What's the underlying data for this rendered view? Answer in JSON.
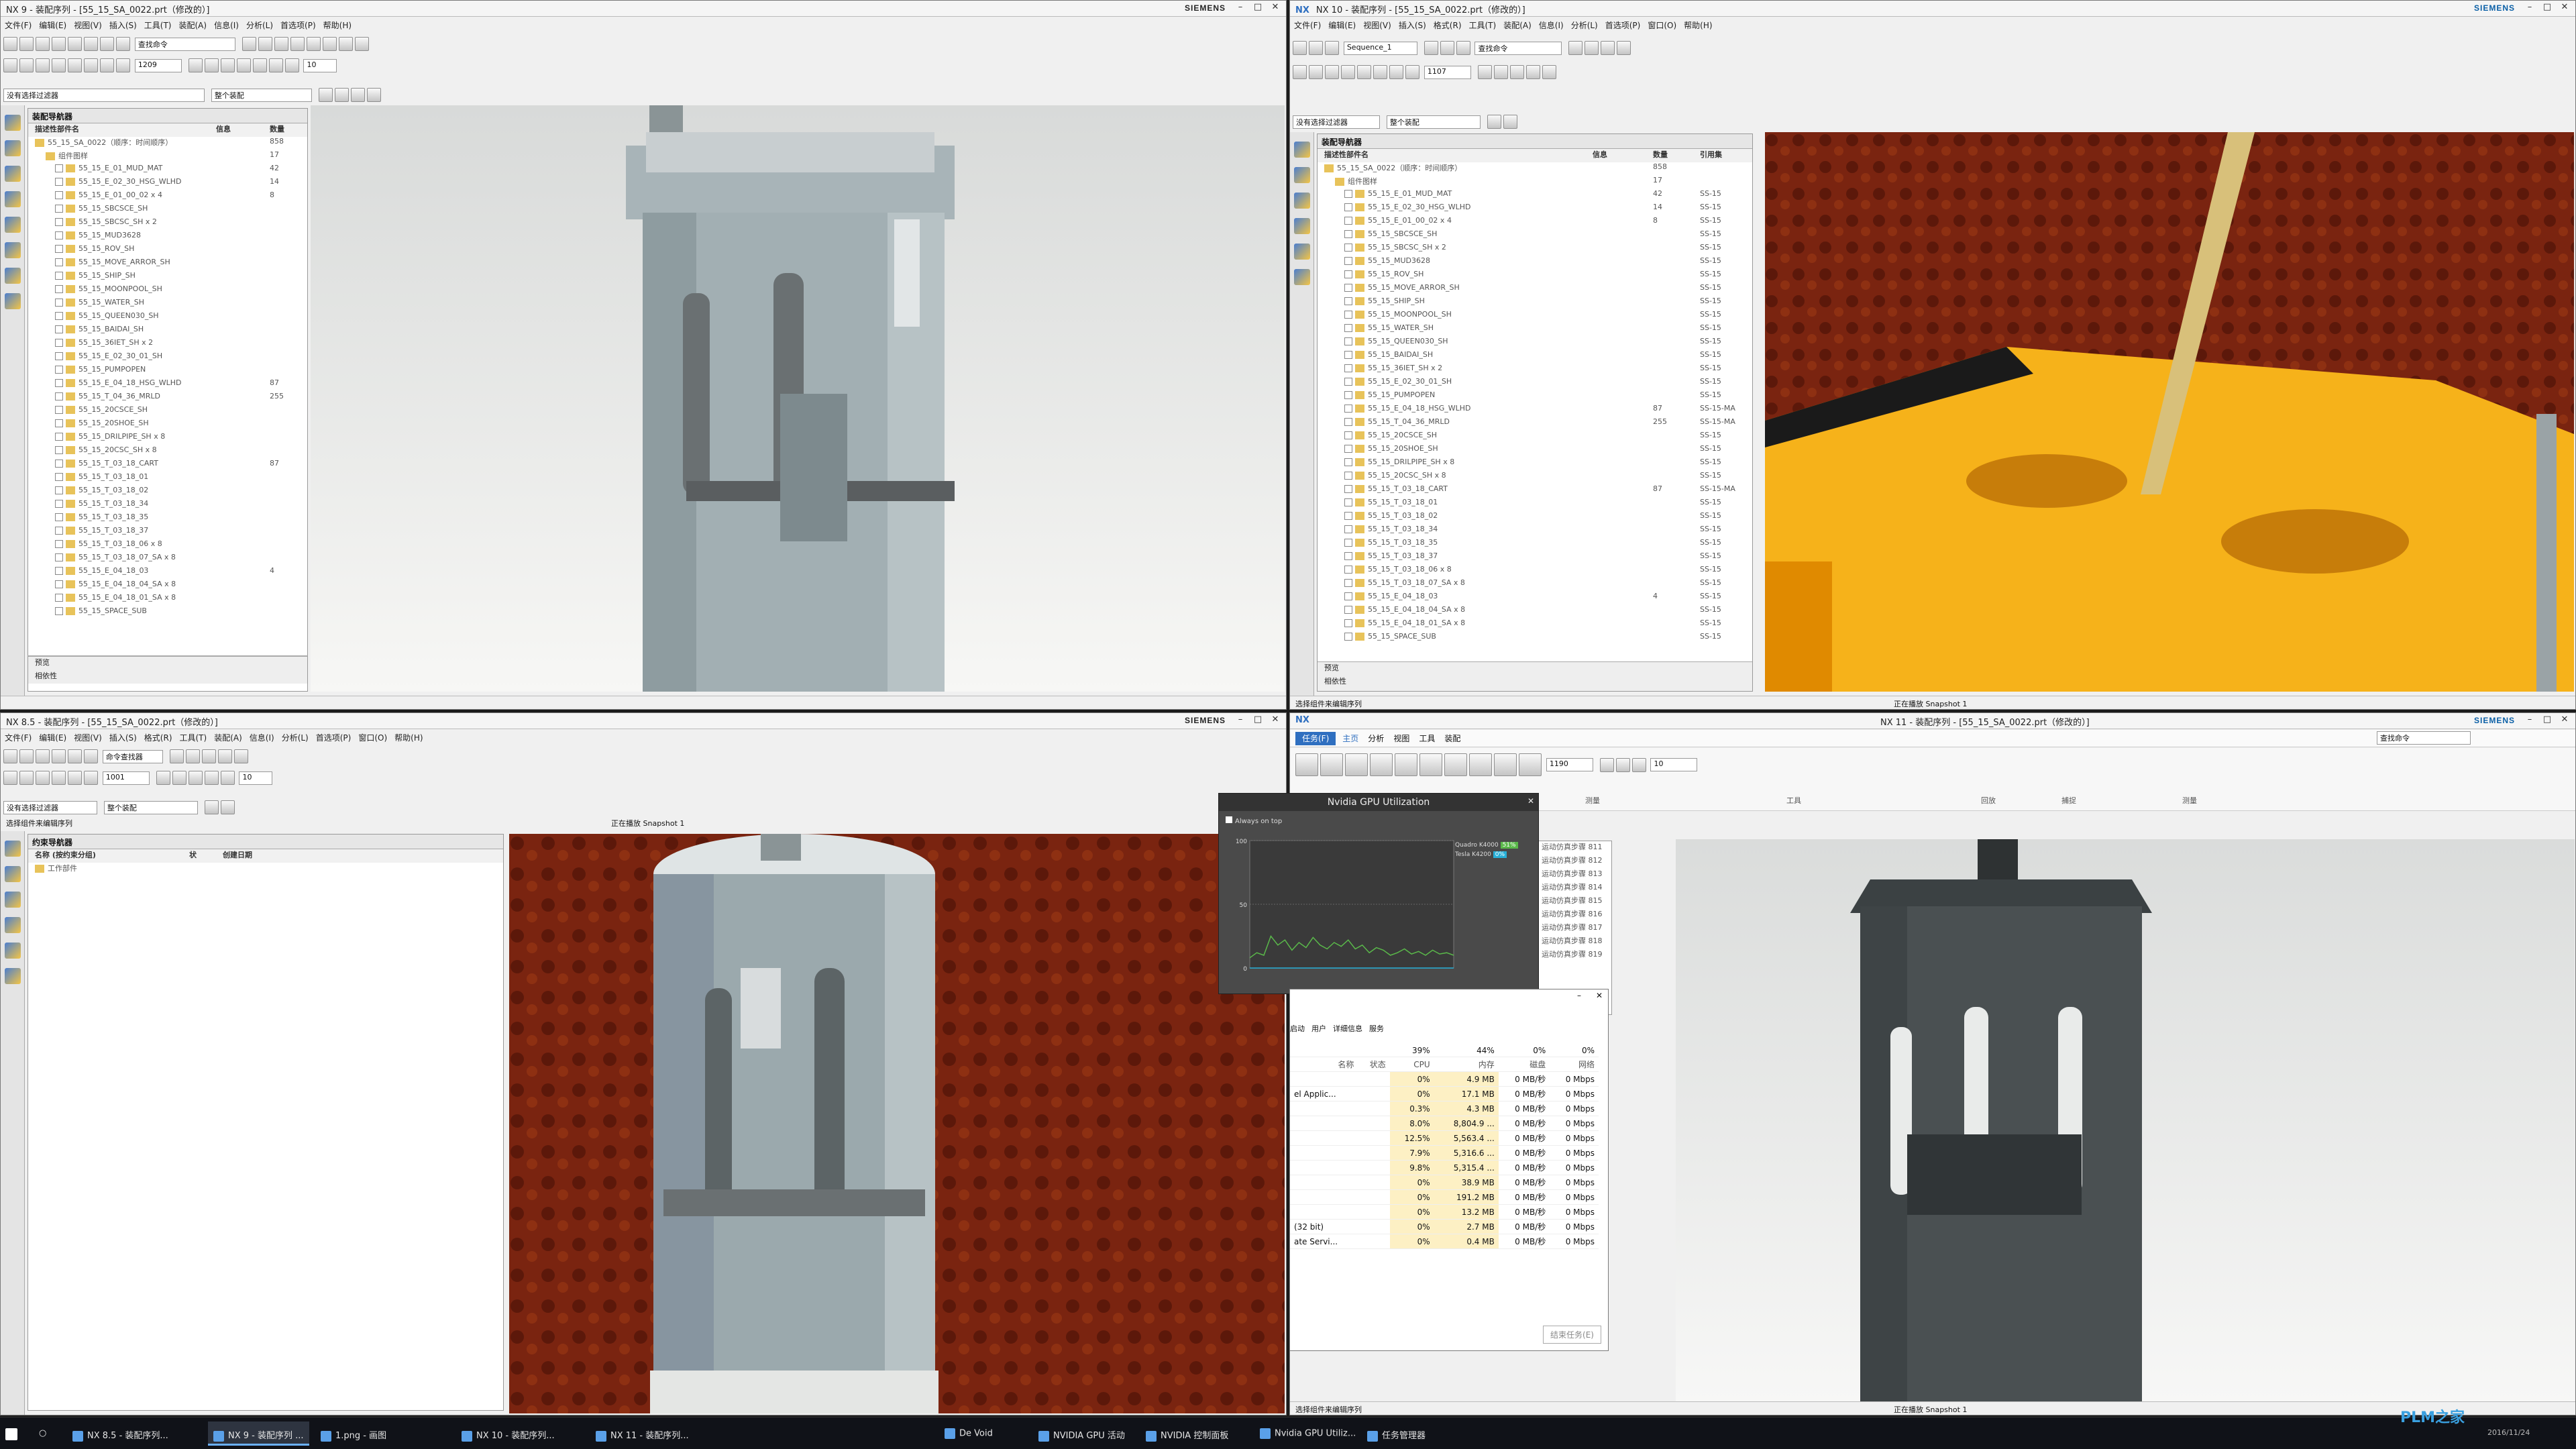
{
  "w1": {
    "title": "NX 9 - 装配序列 - [55_15_SA_0022.prt（修改的）]",
    "brand": "SIEMENS",
    "menu": [
      "文件(F)",
      "编辑(E)",
      "视图(V)",
      "插入(S)",
      "工具(T)",
      "装配(A)",
      "信息(I)",
      "分析(L)",
      "首选项(P)",
      "帮助(H)"
    ],
    "filter": "没有选择过滤器",
    "scope": "整个装配",
    "cmd": "查找命令",
    "frame": "1209",
    "step": "10",
    "nav_title": "装配导航器",
    "cols": [
      "描述性部件名",
      "信息",
      "数量"
    ],
    "root": "55_15_SA_0022（顺序：时间顺序）",
    "root_qty": "858",
    "group": "组件图样",
    "group_qty": "17",
    "rows": [
      "55_15_E_01_MUD_MAT",
      "55_15_E_02_30_HSG_WLHD",
      "55_15_E_01_00_02 x 4",
      "55_15_SBCSCE_SH",
      "55_15_SBCSC_SH x 2",
      "55_15_MUD3628",
      "55_15_ROV_SH",
      "55_15_MOVE_ARROR_SH",
      "55_15_SHIP_SH",
      "55_15_MOONPOOL_SH",
      "55_15_WATER_SH",
      "55_15_QUEEN030_SH",
      "55_15_BAIDAI_SH",
      "55_15_36IET_SH x 2",
      "55_15_E_02_30_01_SH",
      "55_15_PUMPOPEN",
      "55_15_E_04_18_HSG_WLHD",
      "55_15_T_04_36_MRLD",
      "55_15_20CSCE_SH",
      "55_15_20SHOE_SH",
      "55_15_DRILPIPE_SH x 8",
      "55_15_20CSC_SH x 8",
      "55_15_T_03_18_CART",
      "55_15_T_03_18_01",
      "55_15_T_03_18_02",
      "55_15_T_03_18_34",
      "55_15_T_03_18_35",
      "55_15_T_03_18_37",
      "55_15_T_03_18_06 x 8",
      "55_15_T_03_18_07_SA x 8",
      "55_15_E_04_18_03",
      "55_15_E_04_18_04_SA x 8",
      "55_15_E_04_18_01_SA x 8",
      "55_15_SPACE_SUB"
    ],
    "qty": {
      "0": "42",
      "1": "14",
      "2": "8",
      "16": "87",
      "17": "255",
      "22": "87",
      "30": "4"
    },
    "sec": [
      "预览",
      "相依性"
    ]
  },
  "w2": {
    "title": "NX 10 - 装配序列 - [55_15_SA_0022.prt（修改的）]",
    "brand": "SIEMENS",
    "logo": "NX",
    "menu": [
      "文件(F)",
      "编辑(E)",
      "视图(V)",
      "插入(S)",
      "格式(R)",
      "工具(T)",
      "装配(A)",
      "信息(I)",
      "分析(L)",
      "首选项(P)",
      "窗口(O)",
      "帮助(H)"
    ],
    "seq": "Sequence_1",
    "cmd": "查找命令",
    "frame": "1107",
    "filter": "没有选择过滤器",
    "scope": "整个装配",
    "nav_title": "装配导航器",
    "cols": [
      "描述性部件名",
      "信息",
      "数量",
      "引用集"
    ],
    "root": "55_15_SA_0022（顺序：时间顺序）",
    "root_qty": "858",
    "group": "组件图样",
    "group_qty": "17",
    "ref": "SS-15",
    "ref2": "SS-15-MA",
    "sec": [
      "预览",
      "相依性"
    ],
    "status": "选择组件来编辑序列",
    "status2": "正在播放 Snapshot 1"
  },
  "w3": {
    "title": "NX 8.5 - 装配序列 - [55_15_SA_0022.prt（修改的）]",
    "brand": "SIEMENS",
    "menu": [
      "文件(F)",
      "编辑(E)",
      "视图(V)",
      "插入(S)",
      "格式(R)",
      "工具(T)",
      "装配(A)",
      "信息(I)",
      "分析(L)",
      "首选项(P)",
      "窗口(O)",
      "帮助(H)"
    ],
    "filter": "没有选择过滤器",
    "scope": "整个装配",
    "frame": "1001",
    "step": "10",
    "cmd": "命令查找器",
    "status": "选择组件来编辑序列",
    "playing": "正在播放 Snapshot 1",
    "nav_title": "约束导航器",
    "cols": [
      "名称 (按约束分组)",
      "状",
      "创建日期"
    ],
    "row1": "工作部件"
  },
  "w4": {
    "title": "NX 11 - 装配序列 - [55_15_SA_0022.prt（修改的）]",
    "brand": "SIEMENS",
    "logo": "NX",
    "search": "查找命令",
    "tabs": [
      "任务(F)",
      "主页",
      "分析",
      "视图",
      "工具",
      "装配"
    ],
    "ribbon_groups": [
      "测量",
      "工具",
      "回放",
      "捕捉",
      "测量"
    ],
    "steps": [
      "运动仿真步骤 811",
      "运动仿真步骤 812",
      "运动仿真步骤 813",
      "运动仿真步骤 814",
      "运动仿真步骤 815",
      "运动仿真步骤 816",
      "运动仿真步骤 817",
      "运动仿真步骤 818",
      "运动仿真步骤 819"
    ],
    "status": "选择组件来编辑序列",
    "status2": "正在播放 Snapshot 1",
    "frame": "1190",
    "step": "10"
  },
  "gpu": {
    "title": "Nvidia GPU Utilization",
    "always": "Always on top",
    "y100": "100",
    "y50": "50",
    "y0": "0",
    "legend": [
      {
        "name": "Quadro K4000",
        "value": "51%",
        "color": "#5ab84a"
      },
      {
        "name": "Tesla K4200",
        "value": "0%",
        "color": "#28b0d8"
      }
    ],
    "chart_data": {
      "type": "line",
      "ylim": [
        0,
        100
      ],
      "series": [
        {
          "name": "Quadro K4000",
          "values": [
            8,
            12,
            10,
            25,
            18,
            22,
            14,
            20,
            16,
            24,
            18,
            15,
            20,
            17,
            22,
            15,
            18,
            12,
            16,
            14,
            10,
            12,
            15,
            11,
            13,
            10,
            14,
            11,
            12,
            10
          ]
        },
        {
          "name": "Tesla K4200",
          "values": [
            0,
            0,
            0,
            0,
            0,
            0,
            0,
            0,
            0,
            0,
            0,
            0,
            0,
            0,
            0,
            0,
            0,
            0,
            0,
            0,
            0,
            0,
            0,
            0,
            0,
            0,
            0,
            0,
            0,
            0
          ]
        }
      ]
    }
  },
  "tm": {
    "tabs": [
      "启动",
      "用户",
      "详细信息",
      "服务"
    ],
    "head": [
      "名称",
      "状态",
      "CPU",
      "内存",
      "磁盘",
      "网络"
    ],
    "pct": [
      "39%",
      "44%",
      "0%",
      "0%"
    ],
    "rows": [
      [
        "",
        "",
        "0%",
        "4.9 MB",
        "0 MB/秒",
        "0 Mbps"
      ],
      [
        "el Applic...",
        "",
        "0%",
        "17.1 MB",
        "0 MB/秒",
        "0 Mbps"
      ],
      [
        "",
        "",
        "0.3%",
        "4.3 MB",
        "0 MB/秒",
        "0 Mbps"
      ],
      [
        "",
        "",
        "8.0%",
        "8,804.9 ...",
        "0 MB/秒",
        "0 Mbps"
      ],
      [
        "",
        "",
        "12.5%",
        "5,563.4 ...",
        "0 MB/秒",
        "0 Mbps"
      ],
      [
        "",
        "",
        "7.9%",
        "5,316.6 ...",
        "0 MB/秒",
        "0 Mbps"
      ],
      [
        "",
        "",
        "9.8%",
        "5,315.4 ...",
        "0 MB/秒",
        "0 Mbps"
      ],
      [
        "",
        "",
        "0%",
        "38.9 MB",
        "0 MB/秒",
        "0 Mbps"
      ],
      [
        "",
        "",
        "0%",
        "191.2 MB",
        "0 MB/秒",
        "0 Mbps"
      ],
      [
        "",
        "",
        "0%",
        "13.2 MB",
        "0 MB/秒",
        "0 Mbps"
      ],
      [
        "(32 bit)",
        "",
        "0%",
        "2.7 MB",
        "0 MB/秒",
        "0 Mbps"
      ],
      [
        "ate Servi...",
        "",
        "0%",
        "0.4 MB",
        "0 MB/秒",
        "0 Mbps"
      ]
    ],
    "end": "结束任务(E)"
  },
  "taskbar": {
    "items": [
      "NX 8.5 - 装配序列...",
      "NX 9 - 装配序列 ...",
      "1.png - 画图",
      "NX 10 - 装配序列...",
      "NX 11 - 装配序列...",
      "De Void",
      "NVIDIA GPU 活动",
      "NVIDIA 控制面板",
      "Nvidia GPU Utiliz...",
      "任务管理器"
    ],
    "clock": "2016/11/24",
    "watermark": "PLM之家"
  }
}
